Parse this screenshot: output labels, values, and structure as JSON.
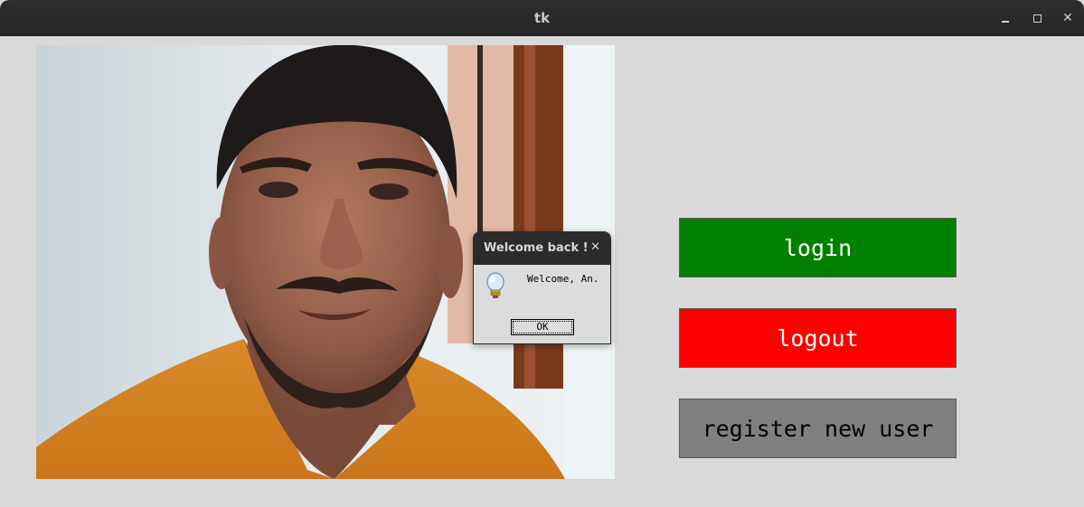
{
  "window": {
    "title": "tk",
    "controls": [
      "minimize-icon",
      "maximize-icon",
      "close-icon"
    ]
  },
  "camera_view": {
    "description_icon": "camera-frame"
  },
  "buttons": {
    "login": {
      "label": "login",
      "color": "#008000"
    },
    "logout": {
      "label": "logout",
      "color": "#ff0000"
    },
    "register": {
      "label": "register new user",
      "color": "#808080"
    }
  },
  "dialog": {
    "title": "Welcome back !",
    "message": "Welcome, An.",
    "ok_label": "OK",
    "icon": "lightbulb-icon"
  }
}
